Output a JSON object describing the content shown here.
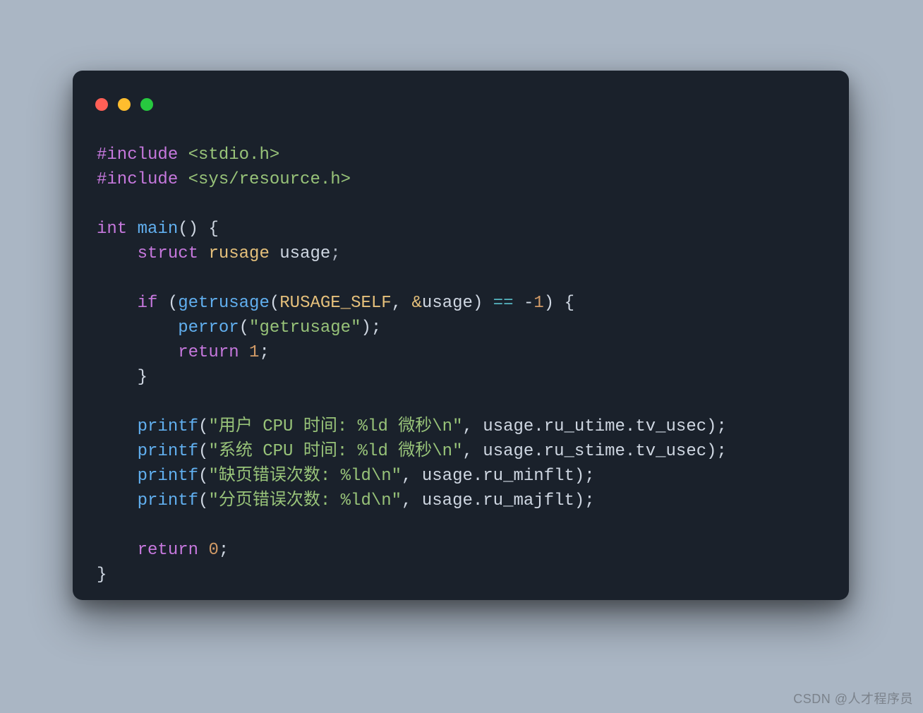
{
  "window": {
    "buttons": [
      "close",
      "minimize",
      "zoom"
    ]
  },
  "code": {
    "include1_kw": "#include",
    "include1_hdr": "<stdio.h>",
    "include2_kw": "#include",
    "include2_hdr": "<sys/resource.h>",
    "kw_int": "int",
    "fn_main": "main",
    "main_sig_tail": "() {",
    "kw_struct": "struct",
    "ty_rusage": "rusage",
    "id_usage": "usage",
    "semi": ";",
    "kw_if": "if",
    "fn_getrusage": "getrusage",
    "const_rusage_self": "RUSAGE_SELF",
    "amp": "&",
    "op_eq": "==",
    "neg1_minus": "-",
    "neg1_one": "1",
    "fn_perror": "perror",
    "str_perror": "\"getrusage\"",
    "kw_return": "return",
    "num_1": "1",
    "fn_printf": "printf",
    "str_p1": "\"用户 CPU 时间: %ld 微秒\\n\"",
    "expr_p1": ", usage.ru_utime.tv_usec);",
    "str_p2": "\"系统 CPU 时间: %ld 微秒\\n\"",
    "expr_p2": ", usage.ru_stime.tv_usec);",
    "str_p3": "\"缺页错误次数: %ld\\n\"",
    "expr_p3": ", usage.ru_minflt);",
    "str_p4": "\"分页错误次数: %ld\\n\"",
    "expr_p4": ", usage.ru_majflt);",
    "num_0": "0",
    "brace_close": "}"
  },
  "watermark": "CSDN @人才程序员"
}
